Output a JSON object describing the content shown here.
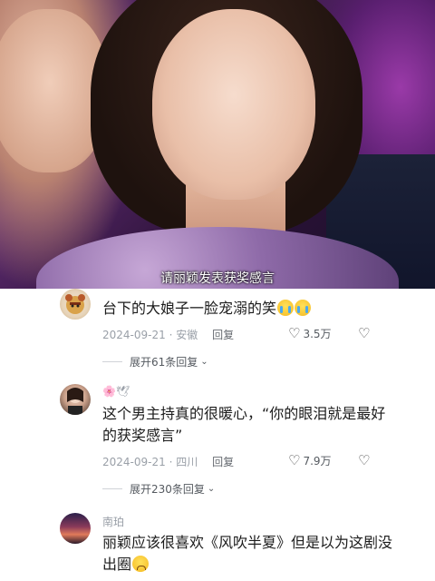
{
  "video": {
    "subtitle": "请丽颖发表获奖感言"
  },
  "comments": [
    {
      "username": "",
      "text": "台下的大娘子一脸宠溺的笑",
      "emojis": [
        "crying-face",
        "crying-face"
      ],
      "date": "2024-09-21",
      "location": "安徽",
      "reply_label": "回复",
      "likes": "3.5万",
      "expand_label": "展开61条回复"
    },
    {
      "username": "🌸🕊",
      "text": "这个男主持真的很暖心，“你的眼泪就是最好的获奖感言”",
      "date": "2024-09-21",
      "location": "四川",
      "reply_label": "回复",
      "likes": "7.9万",
      "expand_label": "展开230条回复"
    },
    {
      "username": "南珀",
      "text": "丽颖应该很喜欢《风吹半夏》但是以为这剧没出圈",
      "emojis": [
        "pleading-face"
      ]
    }
  ],
  "separator": "·",
  "colors": {
    "meta_gray": "#9aa0a8",
    "text_dark": "#1c1c1c",
    "background": "#ffffff"
  }
}
